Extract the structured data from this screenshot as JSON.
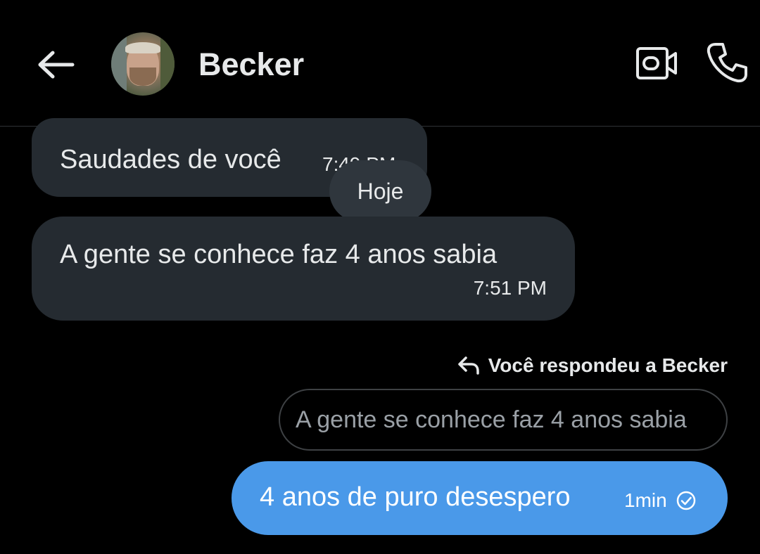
{
  "header": {
    "contact_name": "Becker",
    "back_icon": "arrow-left-icon",
    "video_icon": "video-camera-icon",
    "call_icon": "phone-icon"
  },
  "messages": {
    "incoming": [
      {
        "text": "Saudades de você",
        "time": "7:49 PM"
      },
      {
        "text": "A gente se conhece faz 4 anos sabia",
        "time": "7:51 PM"
      }
    ],
    "date_separator": "Hoje",
    "reply_label": "Você respondeu a Becker",
    "quoted_text": "A gente se conhece faz 4 anos sabia",
    "outgoing": {
      "text": "4 anos de puro desespero",
      "time": "1min",
      "status_icon": "check-circle-icon"
    }
  },
  "colors": {
    "background": "#000000",
    "incoming_bubble": "#252b31",
    "outgoing_bubble": "#4a99e9",
    "text": "#e7e9ea"
  }
}
